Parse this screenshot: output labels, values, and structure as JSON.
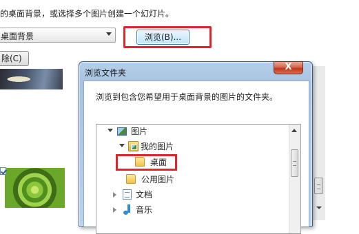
{
  "background_panel": {
    "description": "的桌面背景，或选择多个图片创建一个幻灯片。",
    "location_value": "桌面背景",
    "browse_label": "浏览(B)...",
    "remove_label": "除(C)"
  },
  "dialog": {
    "title": "浏览文件夹",
    "close_label": "X",
    "instruction": "浏览到包含您希望用于桌面背景的图片的文件夹。",
    "tree": [
      {
        "label": "图片",
        "icon": "pictures-icon",
        "expanded": true
      },
      {
        "label": "我的图片",
        "icon": "my-pictures-library-icon",
        "expanded": true
      },
      {
        "label": "桌面",
        "icon": "folder-icon",
        "expanded": false,
        "highlighted": true
      },
      {
        "label": "公用图片",
        "icon": "folder-icon",
        "expanded": false
      },
      {
        "label": "文档",
        "icon": "documents-icon",
        "expanded": false
      },
      {
        "label": "音乐",
        "icon": "music-icon",
        "expanded": false
      }
    ]
  },
  "colors": {
    "highlight_red": "#e0242b",
    "dialog_frame": "#a8c3e1",
    "close_button": "#c0381b"
  }
}
